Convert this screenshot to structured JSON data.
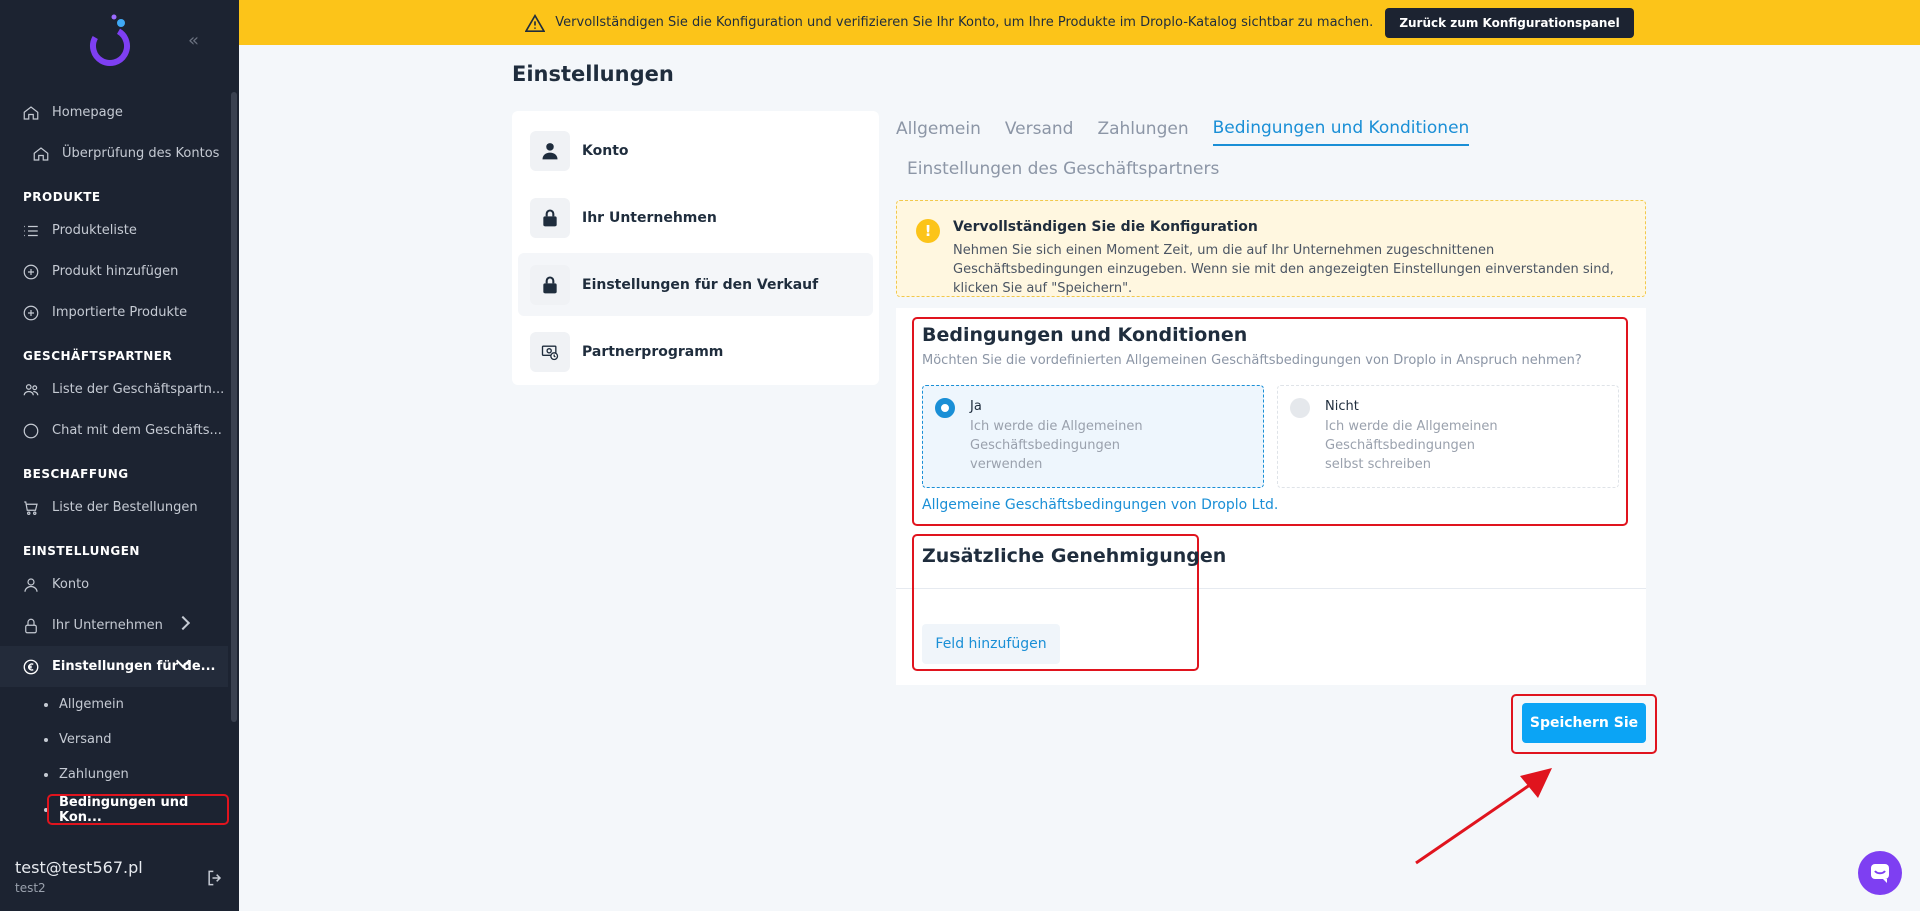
{
  "banner": {
    "text": "Vervollständigen Sie die Konfiguration und verifizieren Sie Ihr Konto, um Ihre Produkte im Droplo-Katalog sichtbar zu machen.",
    "button": "Zurück zum Konfigurationspanel"
  },
  "sidebar": {
    "top": [
      {
        "label": "Homepage",
        "icon": "home-icon"
      },
      {
        "label": "Überprüfung des Kontos",
        "icon": "home-icon"
      }
    ],
    "produkte": {
      "heading": "PRODUKTE",
      "items": [
        "Produkteliste",
        "Produkt hinzufügen",
        "Importierte Produkte"
      ]
    },
    "partner": {
      "heading": "GESCHÄFTSPARTNER",
      "items": [
        "Liste der Geschäftspartn...",
        "Chat mit dem Geschäfts..."
      ]
    },
    "beschaffung": {
      "heading": "BESCHAFFUNG",
      "items": [
        "Liste der Bestellungen"
      ]
    },
    "einstellungen": {
      "heading": "EINSTELLUNGEN",
      "konto": "Konto",
      "unternehmen": "Ihr Unternehmen",
      "verkauf": "Einstellungen für de...",
      "sub": [
        "Allgemein",
        "Versand",
        "Zahlungen",
        "Bedingungen und Kon..."
      ]
    },
    "user": {
      "email": "test@test567.pl",
      "name": "test2"
    }
  },
  "page": {
    "title": "Einstellungen"
  },
  "menu": [
    "Konto",
    "Ihr Unternehmen",
    "Einstellungen für den Verkauf",
    "Partnerprogramm"
  ],
  "tabs": [
    "Allgemein",
    "Versand",
    "Zahlungen",
    "Bedingungen und Konditionen",
    "Einstellungen des Geschäftspartners"
  ],
  "alert": {
    "title": "Vervollständigen Sie die Konfiguration",
    "text": "Nehmen Sie sich einen Moment Zeit, um die auf Ihr Unternehmen zugeschnittenen Geschäftsbedingungen einzugeben. Wenn sie mit den angezeigten Einstellungen einverstanden sind, klicken Sie auf \"Speichern\"."
  },
  "terms": {
    "title": "Bedingungen und Konditionen",
    "question": "Möchten Sie die vordefinierten Allgemeinen Geschäftsbedingungen von Droplo in Anspruch nehmen?",
    "yes_label": "Ja",
    "yes_desc": "Ich werde die Allgemeinen Geschäftsbedingungen verwenden",
    "no_label": "Nicht",
    "no_desc": "Ich werde die Allgemeinen Geschäftsbedingungen selbst schreiben",
    "link": "Allgemeine Geschäftsbedingungen von Droplo Ltd."
  },
  "extra": {
    "title": "Zusätzliche Genehmigungen",
    "add_button": "Feld hinzufügen"
  },
  "save_button": "Speichern Sie",
  "colors": {
    "accent": "#1a8fd6",
    "banner": "#fcc419",
    "sidebar": "#1c2331",
    "highlight": "#e0141e"
  }
}
